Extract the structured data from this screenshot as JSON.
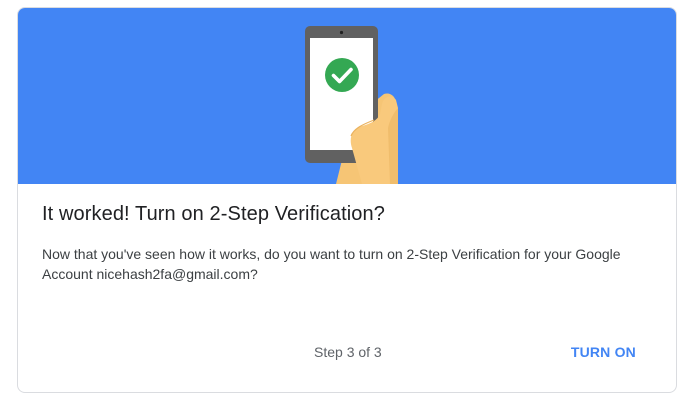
{
  "dialog": {
    "title": "It worked! Turn on 2-Step Verification?",
    "message": "Now that you've seen how it works, do you want to turn on 2-Step Verification for your Google Account nicehash2fa@gmail.com?",
    "step_label": "Step 3 of 3",
    "turn_on_label": "TURN ON"
  },
  "illustration": {
    "icon": "phone-with-checkmark-icon",
    "background_color": "#4285f4",
    "check_color": "#34a853"
  },
  "colors": {
    "accent": "#4285f4",
    "title_text": "#202124",
    "body_text": "#3c4043",
    "muted_text": "#5f6368"
  }
}
